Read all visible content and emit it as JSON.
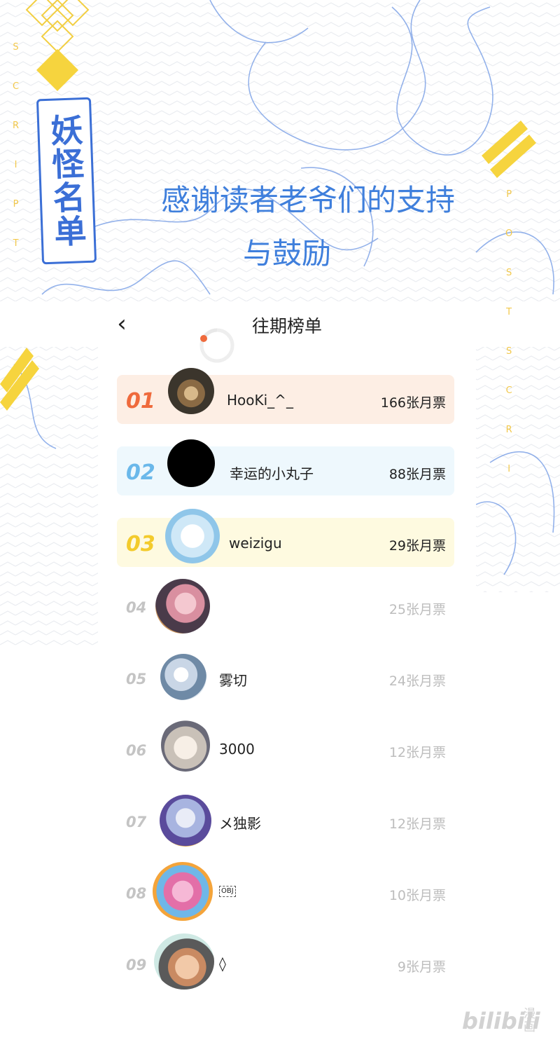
{
  "side_letters": {
    "left": [
      "S",
      "C",
      "R",
      "I",
      "P",
      "T"
    ],
    "right": [
      "P",
      "O",
      "S",
      "T",
      "S",
      "C",
      "R",
      "I"
    ]
  },
  "logo": {
    "text": "妖怪名单"
  },
  "headline": {
    "line1": "感谢读者老爷们的支持",
    "line2": "与鼓励"
  },
  "nav": {
    "back_icon": "‹",
    "title": "往期榜单"
  },
  "colors": {
    "accent_blue": "#3f7fdc",
    "rank1": "#ef6a3c",
    "rank2": "#6ab8ea",
    "rank3": "#f3cb2c",
    "row1_bg": "#fdeee4",
    "row2_bg": "#eef8fd",
    "row3_bg": "#fefae0"
  },
  "leaderboard": [
    {
      "rank": "01",
      "name": "HooKi_^_",
      "votes": "166张月票"
    },
    {
      "rank": "02",
      "name": "幸运的小丸子",
      "votes": "88张月票"
    },
    {
      "rank": "03",
      "name": "weizigu",
      "votes": "29张月票"
    },
    {
      "rank": "04",
      "name": "",
      "votes": "25张月票"
    },
    {
      "rank": "05",
      "name": "雾切",
      "votes": "24张月票"
    },
    {
      "rank": "06",
      "name": "3000",
      "votes": "12张月票"
    },
    {
      "rank": "07",
      "name": "メ独影",
      "votes": "12张月票"
    },
    {
      "rank": "08",
      "name": "OBJ",
      "votes": "10张月票"
    },
    {
      "rank": "09",
      "name": "◊",
      "votes": "9张月票"
    }
  ],
  "watermark": {
    "brand": "bilibili",
    "sub": "漫画"
  }
}
